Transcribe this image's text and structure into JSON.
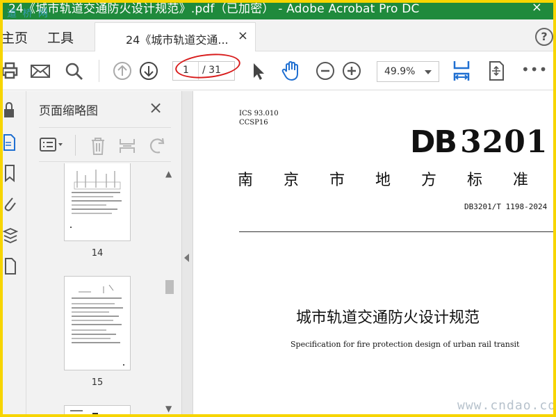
{
  "window": {
    "title": "24《城市轨道交通防火设计规范》.pdf（已加密） - Adobe Acrobat Pro DC",
    "close_label": "×",
    "watermark": "道 桥 网"
  },
  "menubar": {
    "home_label": "主页",
    "tools_label": "工具",
    "help_label": "?"
  },
  "tab": {
    "label": "24《城市轨道交通...",
    "close_label": "×"
  },
  "toolbar": {
    "icons": [
      "print-icon",
      "mail-icon",
      "search-icon",
      "page-up-icon",
      "page-down-icon",
      "select-arrow-icon",
      "hand-icon",
      "zoom-out-icon",
      "zoom-in-icon",
      "fit-width-icon",
      "rotate-page-icon",
      "more-icon"
    ],
    "page_current": "1",
    "page_total": "/ 31",
    "zoom": "49.9%",
    "more_label": "•••",
    "accent_color": "#1f6fd1",
    "highlight_color": "#d81b1b"
  },
  "sidebar": {
    "title": "页面缩略图",
    "close_label": "×",
    "thumbnails": [
      {
        "page": "14"
      },
      {
        "page": "15"
      }
    ]
  },
  "document": {
    "ics": "ICS 93.010",
    "ccs": "CCSP16",
    "db_prefix": "DB",
    "db_number": "3201",
    "standard_name": "南京市地方标准",
    "standard_code": "DB3201/T 1198-2024",
    "title_cn": "城市轨道交通防火设计规范",
    "title_en": "Specification for fire protection design of urban rail transit",
    "site_watermark": "www.cndao.com"
  }
}
